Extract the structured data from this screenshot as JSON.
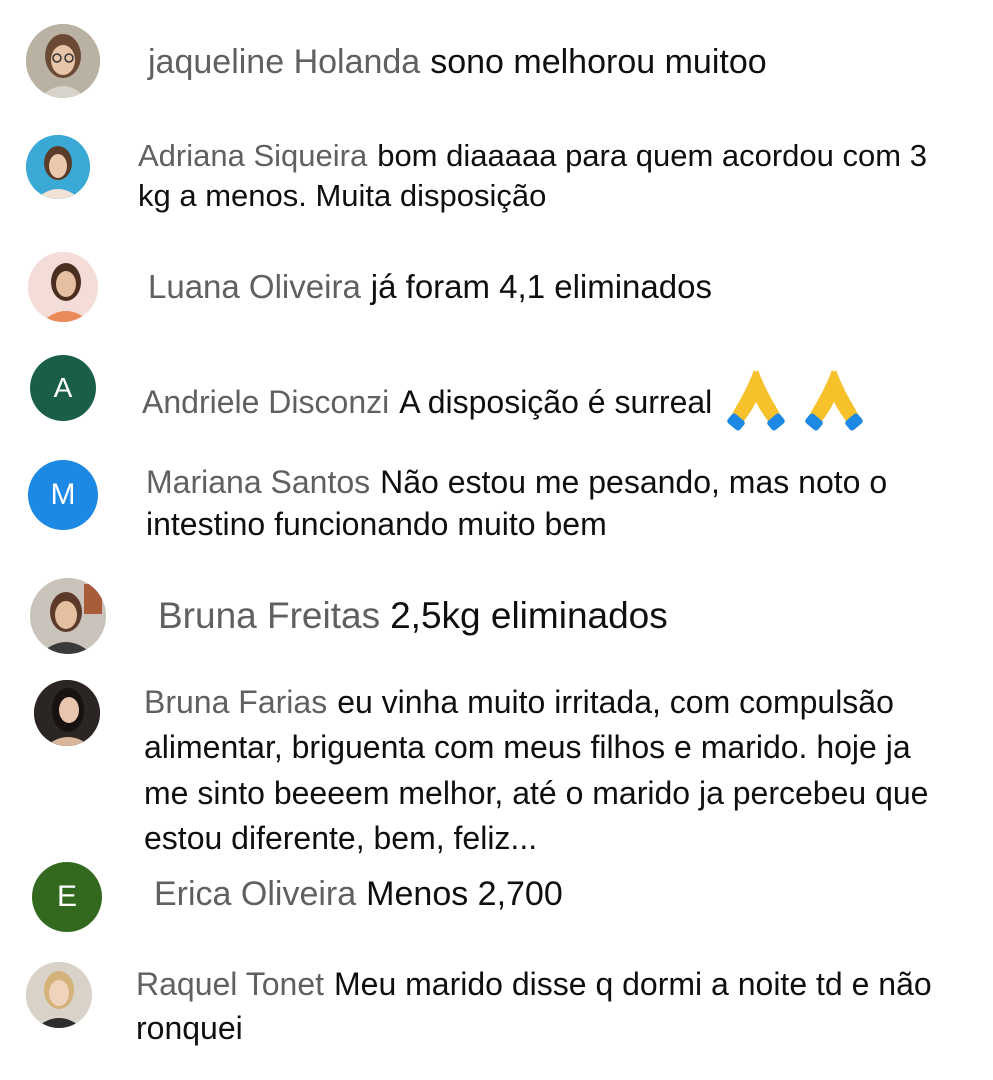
{
  "comments": [
    {
      "author": "jaqueline Holanda",
      "text": "sono melhorou muitoo",
      "avatar": {
        "type": "photo",
        "icon": "woman-glasses-photo-avatar",
        "bg": "#b9b2a3"
      }
    },
    {
      "author": "Adriana Siqueira",
      "text": "bom diaaaaa para quem acordou com 3 kg a menos. Muita disposição",
      "avatar": {
        "type": "photo",
        "icon": "woman-blue-bg-photo-avatar",
        "bg": "#3aa9d6"
      }
    },
    {
      "author": "Luana Oliveira",
      "text": "já foram 4,1 eliminados",
      "avatar": {
        "type": "photo",
        "icon": "woman-pink-bg-photo-avatar",
        "bg": "#f4dcd8"
      }
    },
    {
      "author": "Andriele Disconzi",
      "text": "A disposição é surreal",
      "emoji": "🙏 🙏",
      "avatar": {
        "type": "letter",
        "letter": "A",
        "bg": "#1a5e4a"
      }
    },
    {
      "author": "Mariana Santos",
      "text": "Não estou me pesando, mas noto o intestino funcionando muito bem",
      "avatar": {
        "type": "letter",
        "letter": "M",
        "bg": "#1e88e5"
      }
    },
    {
      "author": "Bruna Freitas",
      "text": "2,5kg eliminados",
      "avatar": {
        "type": "photo",
        "icon": "woman-office-photo-avatar",
        "bg": "#c9c3bb"
      }
    },
    {
      "author": "Bruna Farias",
      "text": "eu vinha muito irritada, com compulsão alimentar, briguenta com meus filhos e marido. hoje ja me sinto beeeem melhor, até o marido ja percebeu que estou diferente, bem, feliz...",
      "avatar": {
        "type": "photo",
        "icon": "woman-dark-hair-photo-avatar",
        "bg": "#2b2523"
      }
    },
    {
      "author": "Erica Oliveira",
      "text": "Menos 2,700",
      "avatar": {
        "type": "letter",
        "letter": "E",
        "bg": "#33691e"
      }
    },
    {
      "author": "Raquel Tonet",
      "text": "Meu marido disse q dormi a noite td e não ronquei",
      "avatar": {
        "type": "photo",
        "icon": "woman-blonde-photo-avatar",
        "bg": "#d8d2c8"
      }
    }
  ]
}
